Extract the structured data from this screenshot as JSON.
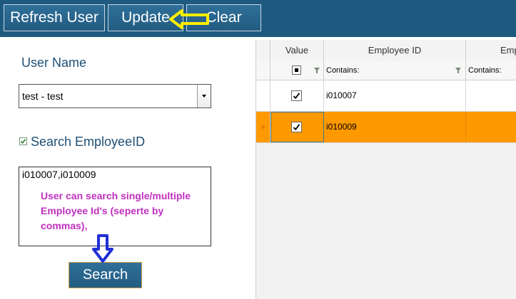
{
  "toolbar": {
    "refresh_label": "Refresh User",
    "update_label": "Update",
    "clear_label": "Clear",
    "background": "#1e5a80"
  },
  "left_panel": {
    "user_name_label": "User Name",
    "user_select_value": "test - test",
    "search_employee_label": "Search EmployeeID",
    "search_employee_checked": true,
    "employee_ids_value": "i010007,i010009",
    "annotation_note": "User can search single/multiple Employee Id's (seperte by commas),",
    "search_button_label": "Search"
  },
  "grid": {
    "columns": [
      "Value",
      "Employee ID",
      "Emp"
    ],
    "filter_placeholder": "Contains:",
    "rows": [
      {
        "checked": true,
        "employee_id": "i010007",
        "selected": false
      },
      {
        "checked": true,
        "employee_id": "i010009",
        "selected": true
      }
    ],
    "selection_color": "#ff9900"
  },
  "annotations": {
    "yellow_arrow_color": "#ffee00",
    "blue_arrow_color": "#1f2fd6",
    "note_color": "#c030c0"
  }
}
